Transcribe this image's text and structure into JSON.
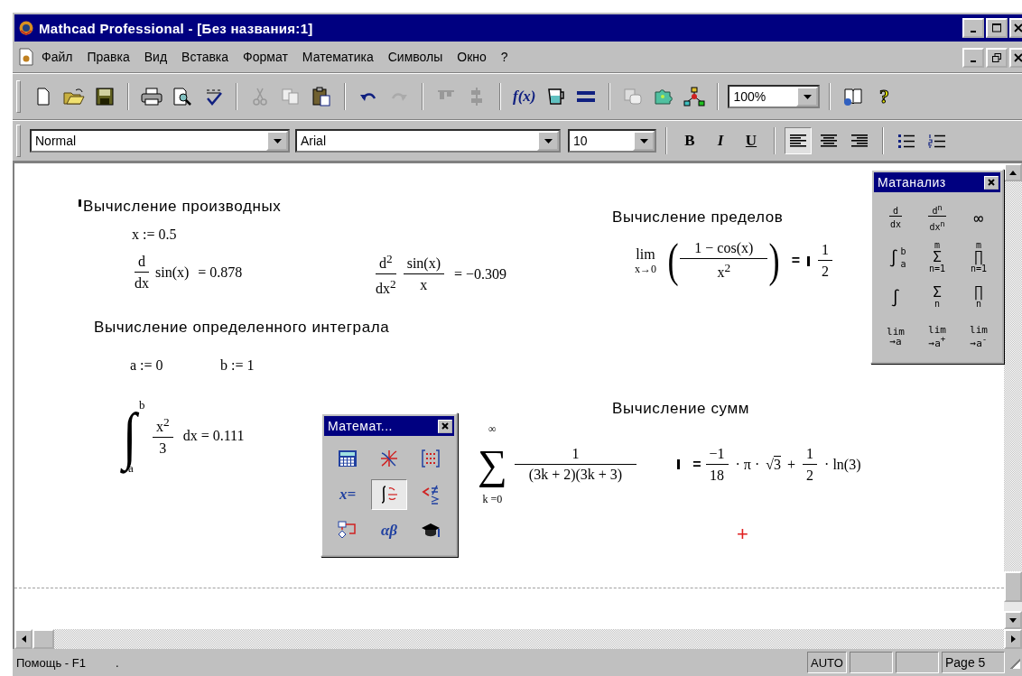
{
  "window": {
    "title": "Mathcad Professional - [Без названия:1]"
  },
  "menu": [
    "Файл",
    "Правка",
    "Вид",
    "Вставка",
    "Формат",
    "Математика",
    "Символы",
    "Окно",
    "?"
  ],
  "toolbar": {
    "function_label": "f(x)",
    "zoom": "100%",
    "help_label": "?"
  },
  "format_bar": {
    "style": "Normal",
    "font": "Arial",
    "size": "10",
    "text_styles": [
      {
        "kind": "bold",
        "label": "B"
      },
      {
        "kind": "italic",
        "label": "I"
      },
      {
        "kind": "underline",
        "label": "U"
      }
    ],
    "align": [
      {
        "kind": "left",
        "selected": true
      },
      {
        "kind": "center",
        "selected": false
      },
      {
        "kind": "right",
        "selected": false
      }
    ]
  },
  "worksheet": {
    "regions": [
      {
        "kind": "heading",
        "text": "Вычисление производных",
        "cursor": true
      },
      {
        "kind": "assign",
        "text": "x := 0.5"
      },
      {
        "kind": "derivative",
        "num": "d",
        "den": "dx",
        "expr": "sin(x)",
        "result": "= 0.878"
      },
      {
        "kind": "derivative2",
        "num": "d$^{2}$",
        "den": "dx$^{2}$",
        "expr_num": "sin(x)",
        "expr_den": "x",
        "result": "= −0.309"
      },
      {
        "kind": "heading",
        "text": "Вычисление пределов",
        "cursor": false
      },
      {
        "kind": "limit",
        "lim": "lim",
        "under": "x→0",
        "open": "(",
        "num": "1 − cos(x)",
        "den": "x$^{2}$",
        "close": ")",
        "eq": "=",
        "res_num": "1",
        "res_den": "2",
        "marker": true
      },
      {
        "kind": "heading",
        "text": "Вычисление определенного интеграла",
        "cursor": false
      },
      {
        "kind": "assign",
        "text": "a := 0"
      },
      {
        "kind": "assign",
        "text": "b := 1"
      },
      {
        "kind": "integral",
        "sign": "∫",
        "upper": "b",
        "lower": "a",
        "num": "x$^{2}$",
        "den": "3",
        "tail": "dx = 0.111"
      },
      {
        "kind": "heading",
        "text": "Вычисление сумм",
        "cursor": false
      },
      {
        "kind": "sum",
        "sign": "∑",
        "upper": "∞",
        "lower": "k =0",
        "num": "1",
        "den": "(3k + 2)(3k + 3)",
        "eq": "=",
        "r1_num": "−1",
        "r1_den": "18",
        "mid": "· π ·",
        "radical": "√",
        "radicand": "3",
        "plus": "+",
        "r2_num": "1",
        "r2_den": "2",
        "tail": "· ln(3)",
        "marker": true
      },
      {
        "kind": "crosshair",
        "text": "+"
      }
    ]
  },
  "calculus_palette": {
    "title": "Матанализ",
    "buttons": [
      {
        "kind": "fraction",
        "top": "d",
        "bottom": "dx"
      },
      {
        "kind": "fraction",
        "top": "d$^{n}$",
        "bottom": "dx$^{n}$"
      },
      {
        "kind": "symbol",
        "symbol": "∞"
      },
      {
        "kind": "integral",
        "symbol": "∫",
        "upper": "b",
        "lower": "a"
      },
      {
        "kind": "stacked",
        "symbol": "Σ",
        "upper": "m",
        "lower": "n=1"
      },
      {
        "kind": "stacked",
        "symbol": "∏",
        "upper": "m",
        "lower": "n=1"
      },
      {
        "kind": "symbol",
        "symbol": "∫"
      },
      {
        "kind": "stacked",
        "symbol": "Σ",
        "lower": "n"
      },
      {
        "kind": "stacked",
        "symbol": "∏",
        "lower": "n"
      },
      {
        "kind": "limit",
        "top": "lim",
        "bottom": "→a"
      },
      {
        "kind": "limit",
        "top": "lim",
        "bottom": "→a$^{+}$"
      },
      {
        "kind": "limit",
        "top": "lim",
        "bottom": "→a$^{-}$"
      }
    ]
  },
  "math_palette": {
    "title": "Математ...",
    "buttons": [
      {
        "kind": "calculator",
        "selected": false
      },
      {
        "kind": "graph",
        "selected": false
      },
      {
        "kind": "matrix",
        "selected": false
      },
      {
        "kind": "evaluation",
        "label": "x=",
        "selected": false
      },
      {
        "kind": "calculus",
        "selected": true
      },
      {
        "kind": "boolean",
        "selected": false
      },
      {
        "kind": "programming",
        "selected": false
      },
      {
        "kind": "greek",
        "label": "αβ",
        "selected": false
      },
      {
        "kind": "symbolic",
        "selected": false
      }
    ]
  },
  "status_bar": {
    "help": "Помощь - F1",
    "dot": ".",
    "mode": "AUTO",
    "page": "Page 5"
  }
}
